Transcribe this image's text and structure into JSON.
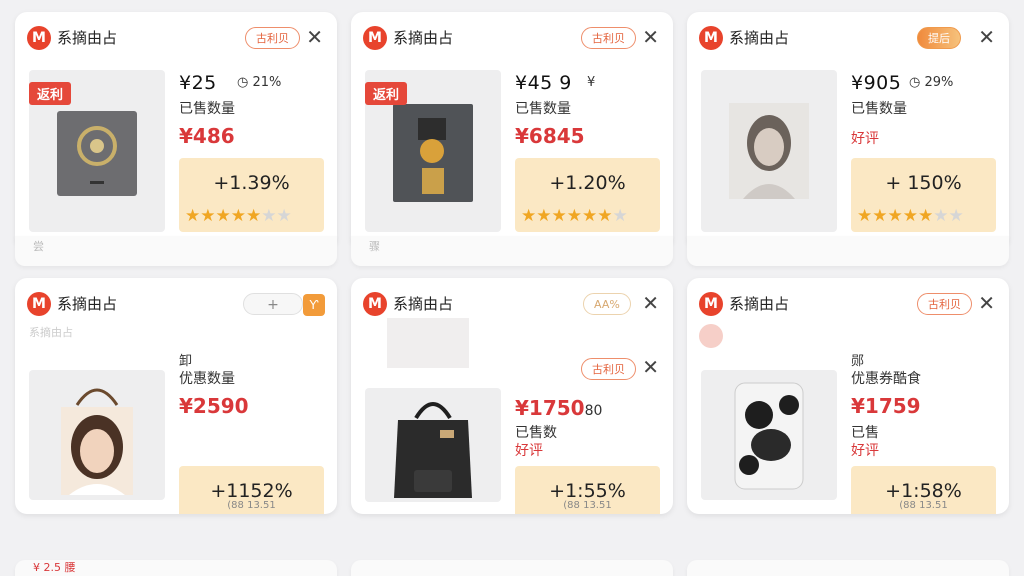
{
  "cards": [
    {
      "shop": "系摘由占",
      "badge": "古利贝",
      "ribbon": "返利",
      "price": "¥25",
      "pct": "21%",
      "label1": "已售数量",
      "red_price": "¥486",
      "score": "+1.39%",
      "rating": 4.5,
      "thumb": "gray-bag-image"
    },
    {
      "shop": "系摘由占",
      "badge": "古利贝",
      "ribbon": "返利",
      "price": "¥45 9",
      "pct": "¥",
      "label1": "已售数量",
      "red_price": "¥6845",
      "score": "+1.20%",
      "rating": 4.5,
      "thumb": "printed-tote-image"
    },
    {
      "shop": "系摘由占",
      "badge": "提后",
      "price": "¥905",
      "pct": "29%",
      "label1": "已售数量",
      "label2": "好评",
      "score": "+ 150%",
      "rating": 4.5,
      "thumb": "portrait-sketch-image"
    },
    {
      "shop": "系摘由占",
      "sub_shop": "系摘由占",
      "label0": "卸",
      "label1": "优惠数量",
      "red_price": "¥2590",
      "score": "+1152%",
      "score_sub": "(88 13.51",
      "rating": 4.5,
      "thumb": "woman-portrait-image"
    },
    {
      "shop": "系摘由占",
      "badge": "AA%",
      "badge2": "古利贝",
      "red_price": "¥1750",
      "red_price_suffix": "80",
      "label1": "已售数",
      "label2": "好评",
      "score": "+1:55%",
      "score_sub": "(88 13.51",
      "rating": 4.5,
      "thumb": "black-tote-image"
    },
    {
      "shop": "系摘由占",
      "badge": "古利贝",
      "label0": "郧",
      "label1": "优惠券酷食",
      "red_price": "¥1759",
      "label2": "已售",
      "label3": "好评",
      "score": "+1:58%",
      "score_sub": "(88 13.51",
      "rating": 4.5,
      "thumb": "cartoon-cup-image"
    }
  ],
  "peek_row": [
    "¥ 2.5 腰",
    "",
    ""
  ]
}
